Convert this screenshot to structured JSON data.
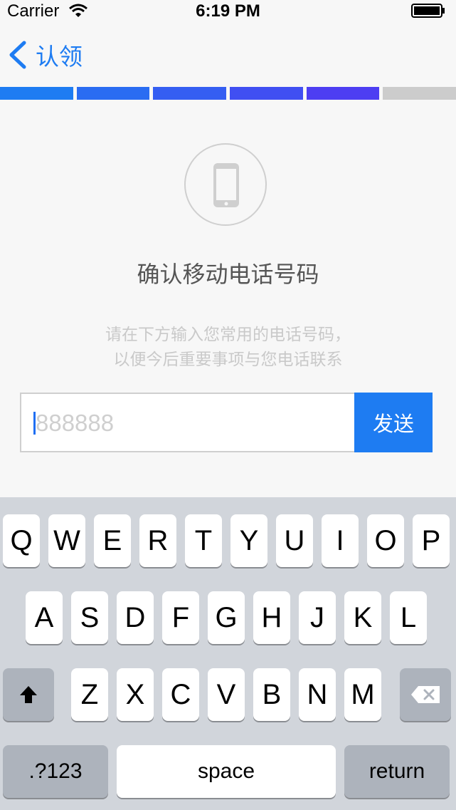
{
  "status_bar": {
    "carrier": "Carrier",
    "time": "6:19 PM"
  },
  "nav": {
    "back_label": "认领"
  },
  "progress": {
    "completed_steps": 5,
    "total_steps": 6,
    "segment_colors": [
      "#1e7cf2",
      "#2a6cf2",
      "#355ef2",
      "#404ff2",
      "#4d3ef2",
      "#cccccc"
    ]
  },
  "hero": {
    "icon": "smartphone-icon"
  },
  "heading": "确认移动电话号码",
  "description": {
    "line1": "请在下方输入您常用的电话号码，",
    "line2": "以便今后重要事项与您电话联系"
  },
  "phone_field": {
    "value": "",
    "placeholder": "888888"
  },
  "send_button": {
    "label": "发送"
  },
  "keyboard": {
    "row1": [
      "Q",
      "W",
      "E",
      "R",
      "T",
      "Y",
      "U",
      "I",
      "O",
      "P"
    ],
    "row2": [
      "A",
      "S",
      "D",
      "F",
      "G",
      "H",
      "J",
      "K",
      "L"
    ],
    "row3": [
      "Z",
      "X",
      "C",
      "V",
      "B",
      "N",
      "M"
    ],
    "shift_icon": "shift-arrow-icon",
    "delete_icon": "backspace-icon",
    "numbers_label": ".?123",
    "space_label": "space",
    "return_label": "return"
  },
  "colors": {
    "accent": "#1e7cf2",
    "keyboard_bg": "#d1d5db",
    "function_key": "#adb3bc"
  }
}
